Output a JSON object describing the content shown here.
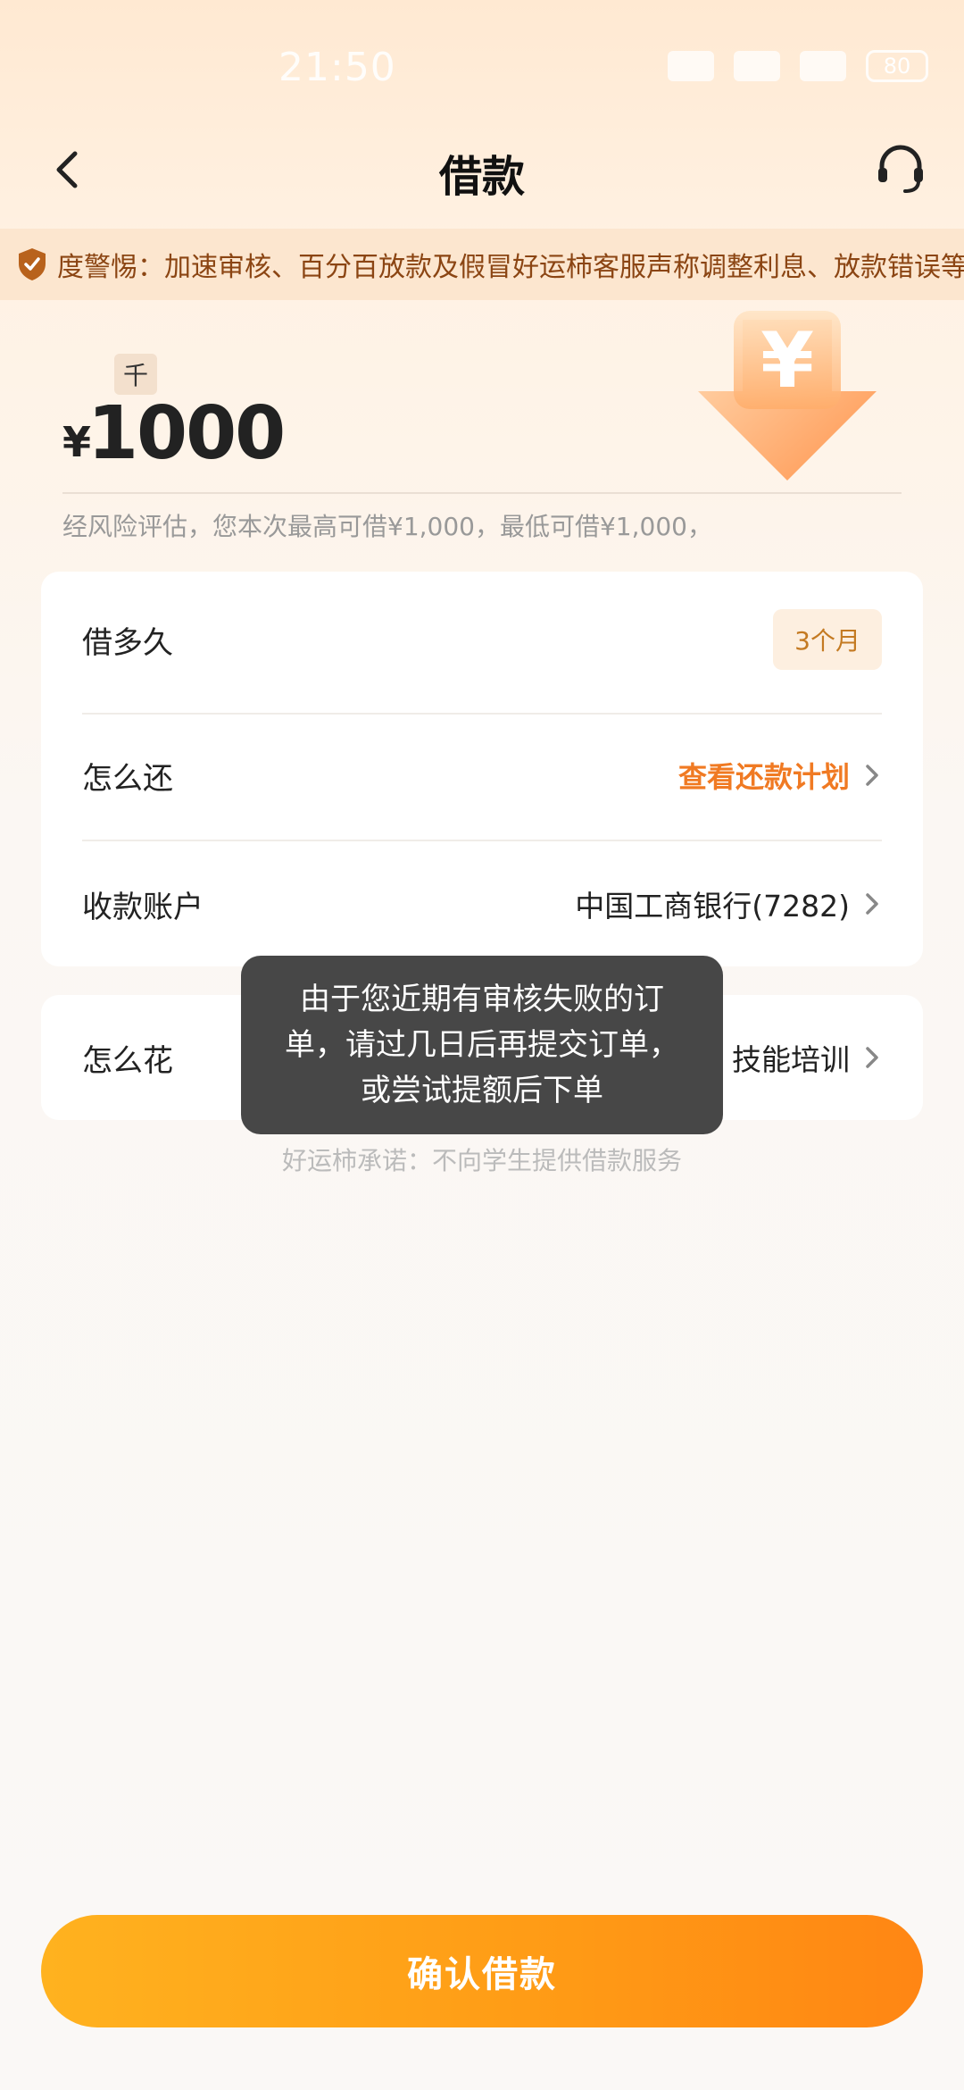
{
  "status": {
    "time": "21:50",
    "battery": "80"
  },
  "header": {
    "title": "借款"
  },
  "notice": {
    "text": "度警惕：加速审核、百分百放款及假冒好运柿客服声称调整利息、放款错误等"
  },
  "amount": {
    "unit": "千",
    "currency": "¥",
    "value": "1000"
  },
  "risk_note": "经风险评估，您本次最高可借¥1,000，最低可借¥1,000，",
  "loan": {
    "term_label": "借多久",
    "term_value": "3个月",
    "repay_label": "怎么还",
    "repay_link": "查看还款计划",
    "account_label": "收款账户",
    "account_value": "中国工商银行(7282)",
    "use_label": "怎么花",
    "use_value": "技能培训"
  },
  "toast": {
    "line1": "由于您近期有审核失败的订",
    "line2": "单，请过几日后再提交订单，",
    "line3": "或尝试提额后下单"
  },
  "promise": "好运柿承诺：不向学生提供借款服务",
  "confirm_button": "确认借款",
  "colors": {
    "accent": "#f07a23",
    "button": "#ff9a15",
    "notice_bg": "#fce6cf"
  }
}
